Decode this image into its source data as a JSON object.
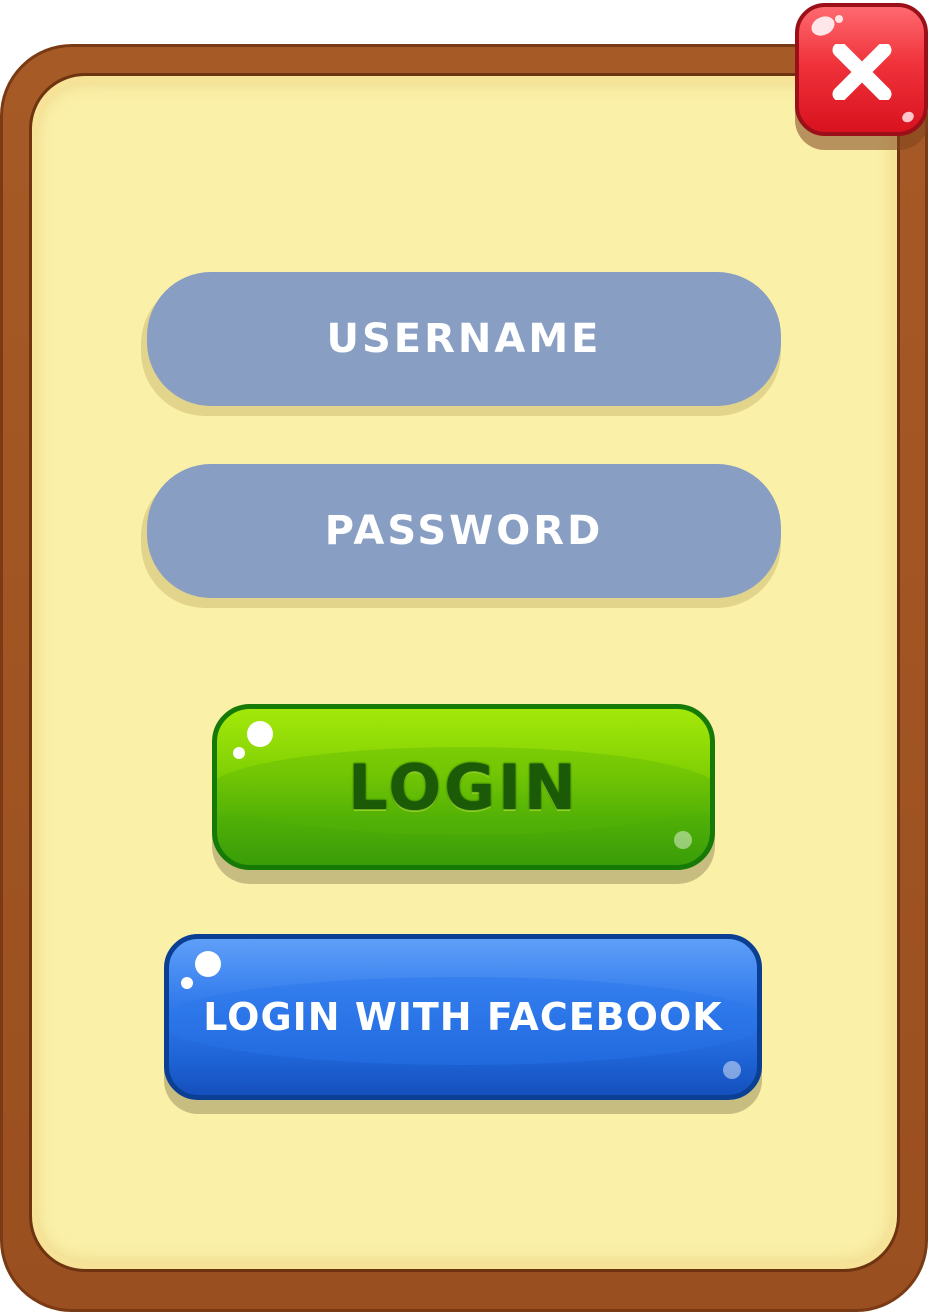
{
  "dialog": {
    "close_icon": "close-x-icon",
    "fields": {
      "username_placeholder": "USERNAME",
      "password_placeholder": "PASSWORD"
    },
    "buttons": {
      "login_label": "LOGIN",
      "facebook_label": "LOGIN WITH FACEBOOK"
    }
  },
  "colors": {
    "frame": "#9a4f20",
    "panel": "#fbf0a8",
    "field": "#899ec3",
    "login_button": "#76c805",
    "facebook_button": "#2f78e8",
    "close_button": "#f0323b"
  }
}
